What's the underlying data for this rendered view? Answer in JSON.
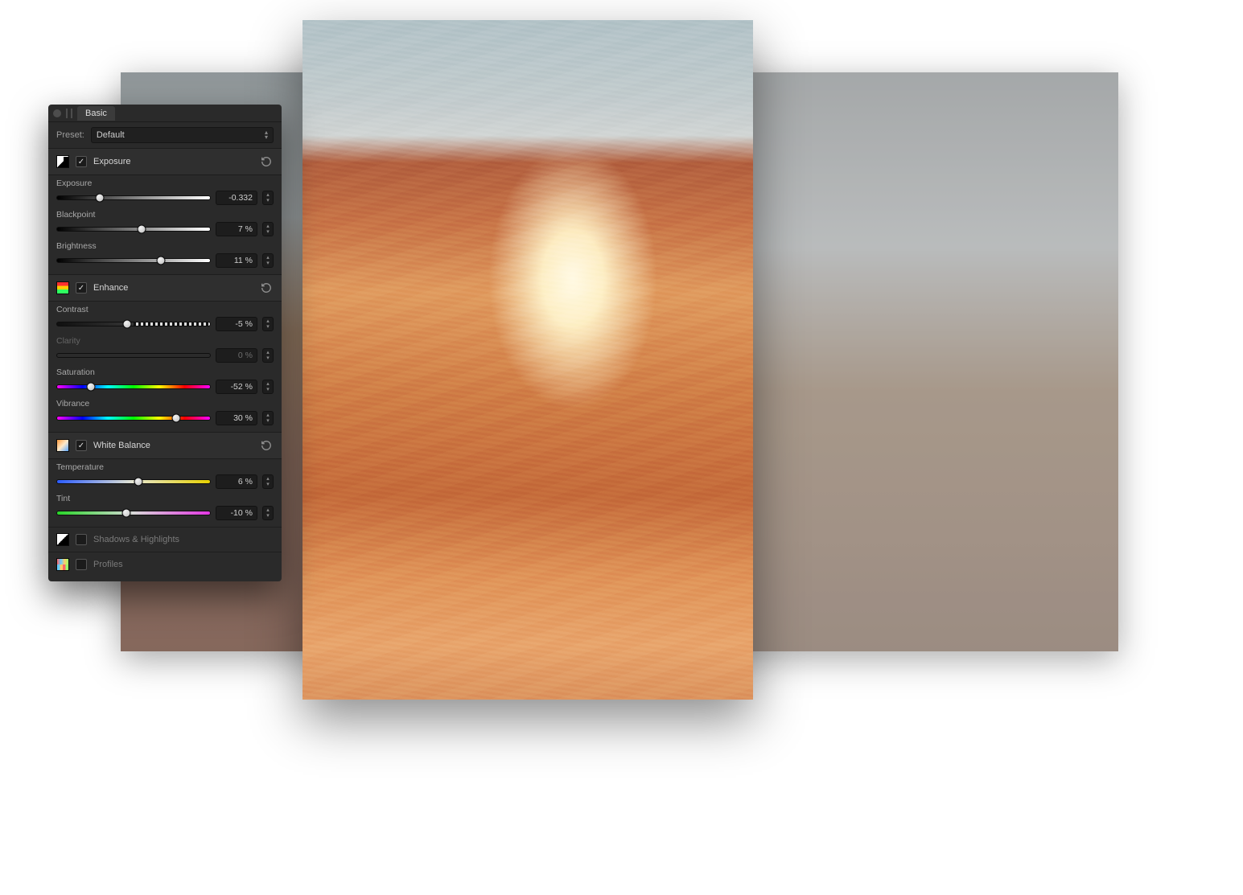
{
  "header": {
    "tab": "Basic"
  },
  "preset": {
    "label": "Preset:",
    "value": "Default"
  },
  "sections": {
    "exposure": {
      "title": "Exposure",
      "enabled": true,
      "params": {
        "exposure": {
          "label": "Exposure",
          "value": "-0.332",
          "pos": 28
        },
        "blackpoint": {
          "label": "Blackpoint",
          "value": "7 %",
          "pos": 55
        },
        "brightness": {
          "label": "Brightness",
          "value": "11 %",
          "pos": 68
        }
      }
    },
    "enhance": {
      "title": "Enhance",
      "enabled": true,
      "params": {
        "contrast": {
          "label": "Contrast",
          "value": "-5 %",
          "pos": 46
        },
        "clarity": {
          "label": "Clarity",
          "value": "0 %",
          "pos": 50
        },
        "saturation": {
          "label": "Saturation",
          "value": "-52 %",
          "pos": 22
        },
        "vibrance": {
          "label": "Vibrance",
          "value": "30 %",
          "pos": 78
        }
      }
    },
    "whiteBalance": {
      "title": "White Balance",
      "enabled": true,
      "params": {
        "temperature": {
          "label": "Temperature",
          "value": "6 %",
          "pos": 53
        },
        "tint": {
          "label": "Tint",
          "value": "-10 %",
          "pos": 45
        }
      }
    },
    "shadowsHighlights": {
      "title": "Shadows & Highlights",
      "enabled": false
    },
    "profiles": {
      "title": "Profiles",
      "enabled": false
    }
  }
}
